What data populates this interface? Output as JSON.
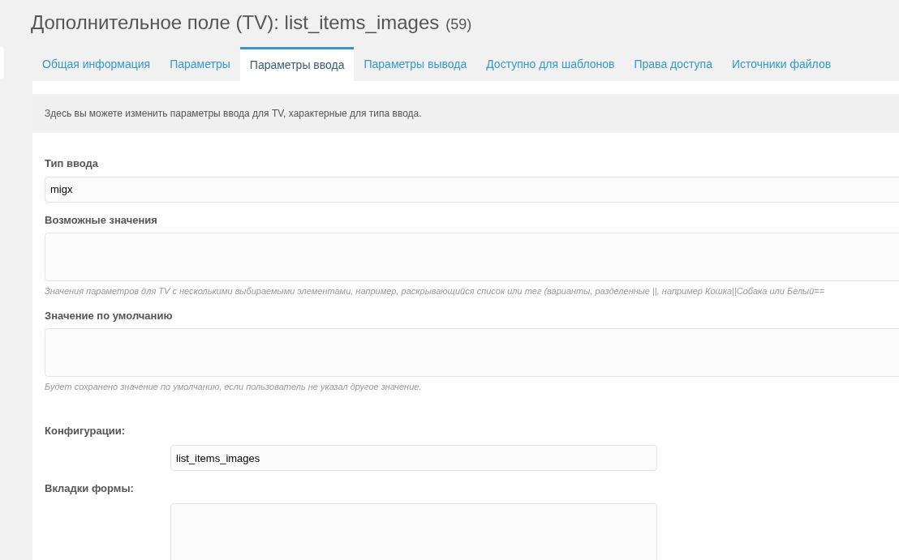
{
  "header": {
    "title": "Дополнительное поле (TV): list_items_images",
    "count": "(59)"
  },
  "tabs": [
    {
      "label": "Общая информация",
      "selected": false
    },
    {
      "label": "Параметры",
      "selected": false
    },
    {
      "label": "Параметры ввода",
      "selected": true
    },
    {
      "label": "Параметры вывода",
      "selected": false
    },
    {
      "label": "Доступно для шаблонов",
      "selected": false
    },
    {
      "label": "Права доступа",
      "selected": false
    },
    {
      "label": "Источники файлов",
      "selected": false
    }
  ],
  "description": "Здесь вы можете изменить параметры ввода для TV, характерные для типа ввода.",
  "fields": [
    {
      "kind": "input",
      "label": "Тип ввода",
      "value": "migx"
    },
    {
      "kind": "textarea",
      "label": "Возможные значения",
      "hint": "Значения параметров для TV с несколькими выбираемыми элементами, например, раскрывающийся список или тег (варианты, разделенные ||, например Кошка||Собака или Белый=="
    },
    {
      "kind": "textarea",
      "label": "Значение по умолчанию",
      "hint": "Будет сохранено значение по умолчанию, если пользователь не указал другое значение."
    },
    {
      "kind": "inline_input",
      "label": "Конфигурации:",
      "value": "list_items_images"
    },
    {
      "kind": "inline_textarea",
      "label": "Вкладки формы:"
    }
  ]
}
